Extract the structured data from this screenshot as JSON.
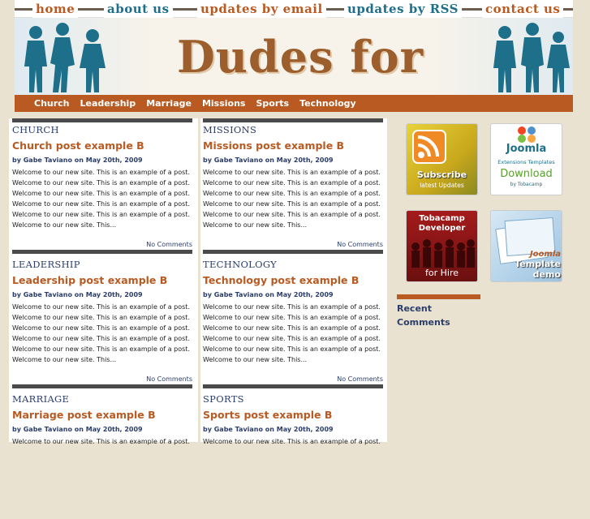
{
  "topnav": {
    "home": "home",
    "about": "about us",
    "updates_email": "updates by email",
    "updates_rss": "updates by RSS",
    "contact": "contact us"
  },
  "header": {
    "site_title": "Dudes for Jesus"
  },
  "mainnav": [
    "Church",
    "Leadership",
    "Marriage",
    "Missions",
    "Sports",
    "Technology"
  ],
  "posts": [
    {
      "category": "CHURCH",
      "title": "Church post example B",
      "byline": "by Gabe Taviano on May 20th, 2009",
      "comments": "No Comments"
    },
    {
      "category": "MISSIONS",
      "title": "Missions post example B",
      "byline": "by Gabe Taviano on May 20th, 2009",
      "comments": "No Comments"
    },
    {
      "category": "LEADERSHIP",
      "title": "Leadership post example B",
      "byline": "by Gabe Taviano on May 20th, 2009",
      "comments": "No Comments"
    },
    {
      "category": "TECHNOLOGY",
      "title": "Technology post example B",
      "byline": "by Gabe Taviano on May 20th, 2009",
      "comments": "No Comments"
    },
    {
      "category": "MARRIAGE",
      "title": "Marriage post example B",
      "byline": "by Gabe Taviano on May 20th, 2009",
      "comments": ""
    },
    {
      "category": "SPORTS",
      "title": "Sports post example B",
      "byline": "by Gabe Taviano on May 20th, 2009",
      "comments": ""
    }
  ],
  "excerpt_lines": [
    "Welcome to our new site. This is an example of a post.",
    "Welcome to our new site. This is an example of a post.",
    "Welcome to our new site. This is an example of a post.",
    "Welcome to our new site. This is an example of a post.",
    "Welcome to our new site. This is an example of a post.",
    "Welcome to our new site. This..."
  ],
  "excerpt_partial": [
    "Welcome to our new site. This is an example of a post."
  ],
  "ads": [
    {
      "line1": "Subscribe",
      "line2": "latest Updates"
    },
    {
      "line1": "Joomla",
      "line2": "Extensions Templates",
      "line3": "Download",
      "line4": "by Tobacamp"
    },
    {
      "line1": "Tobacamp",
      "line2": "Developer",
      "line3": "for Hire"
    },
    {
      "line1": "Joomla",
      "line2": "Template",
      "line3": "demo"
    }
  ],
  "sidebar": {
    "recent_comments": "Recent Comments"
  },
  "colors": {
    "accent": "#b85a22",
    "navy": "#2b3d6a",
    "teal": "#1e6f8a",
    "page_bg": "#e9e2d0"
  }
}
